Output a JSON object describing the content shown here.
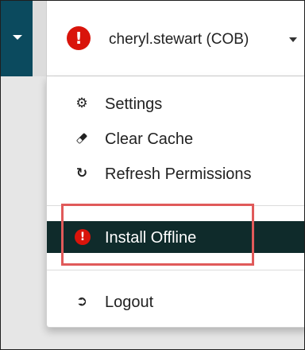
{
  "navbar": {
    "user_label": "cheryl.stewart (COB)",
    "alert_icon": "exclamation-circle-icon",
    "caret_icon": "caret-down-icon",
    "left_caret_icon": "caret-down-icon",
    "colors": {
      "nav_dark": "#0b4a5e",
      "alert_red": "#d9140b"
    }
  },
  "menu": {
    "items": [
      {
        "label": "Settings",
        "icon": "gear-icon"
      },
      {
        "label": "Clear Cache",
        "icon": "eraser-icon"
      },
      {
        "label": "Refresh Permissions",
        "icon": "refresh-icon"
      },
      {
        "label": "Install Offline",
        "icon": "exclamation-circle-icon",
        "active": true
      },
      {
        "label": "Logout",
        "icon": "sign-out-icon"
      }
    ],
    "colors": {
      "active_bg": "#0f2b2b",
      "highlight_border": "#e05a5a"
    }
  }
}
